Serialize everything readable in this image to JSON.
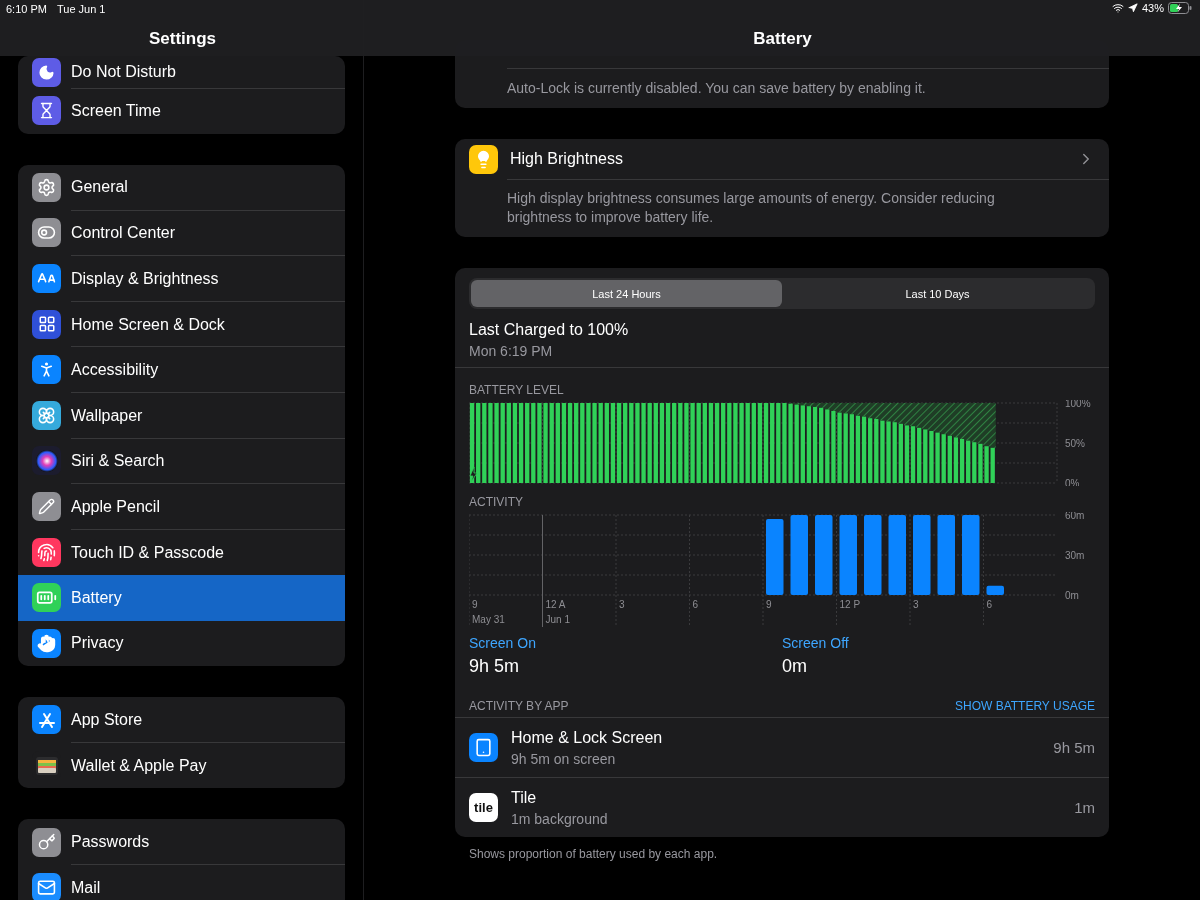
{
  "status_bar": {
    "time": "6:10 PM",
    "date": "Tue Jun 1",
    "battery": "43%"
  },
  "header": {
    "sidebar_title": "Settings",
    "title": "Battery"
  },
  "sidebar": {
    "groups": [
      {
        "items": [
          {
            "label": "Do Not Disturb",
            "kind": "dnd",
            "selected": false
          },
          {
            "label": "Screen Time",
            "kind": "screentime",
            "selected": false
          }
        ]
      },
      {
        "items": [
          {
            "label": "General",
            "kind": "general",
            "selected": false
          },
          {
            "label": "Control Center",
            "kind": "control",
            "selected": false
          },
          {
            "label": "Display & Brightness",
            "kind": "display",
            "selected": false
          },
          {
            "label": "Home Screen & Dock",
            "kind": "home",
            "selected": false
          },
          {
            "label": "Accessibility",
            "kind": "accessibility",
            "selected": false
          },
          {
            "label": "Wallpaper",
            "kind": "wallpaper",
            "selected": false
          },
          {
            "label": "Siri & Search",
            "kind": "siri",
            "selected": false
          },
          {
            "label": "Apple Pencil",
            "kind": "pencil",
            "selected": false
          },
          {
            "label": "Touch ID & Passcode",
            "kind": "touchid",
            "selected": false
          },
          {
            "label": "Battery",
            "kind": "battery",
            "selected": true
          },
          {
            "label": "Privacy",
            "kind": "privacy",
            "selected": false
          }
        ]
      },
      {
        "items": [
          {
            "label": "App Store",
            "kind": "appstore",
            "selected": false
          },
          {
            "label": "Wallet & Apple Pay",
            "kind": "wallet",
            "selected": false
          }
        ]
      },
      {
        "items": [
          {
            "label": "Passwords",
            "kind": "passwords",
            "selected": false
          },
          {
            "label": "Mail",
            "kind": "mail",
            "selected": false
          }
        ]
      }
    ]
  },
  "insights": [
    {
      "description": "Auto-Lock is currently disabled. You can save battery by enabling it."
    },
    {
      "title": "High Brightness",
      "kind": "brightness",
      "description": "High display brightness consumes large amounts of energy. Consider reducing brightness to improve battery life."
    }
  ],
  "usage": {
    "tabs": [
      {
        "label": "Last 24 Hours",
        "selected": true
      },
      {
        "label": "Last 10 Days",
        "selected": false
      }
    ],
    "last_charged": {
      "title": "Last Charged to 100%",
      "time": "Mon 6:19 PM"
    },
    "battery_level": {
      "charging": true,
      "chart_data": {
        "type": "bar",
        "title": "BATTERY LEVEL",
        "ylim": [
          0,
          100
        ],
        "yticks": [
          {
            "value": 0,
            "label": "0%"
          },
          {
            "value": 50,
            "label": "50%"
          },
          {
            "value": 100,
            "label": "100%"
          }
        ],
        "values": [
          100,
          100,
          100,
          100,
          100,
          100,
          100,
          100,
          100,
          100,
          100,
          100,
          100,
          100,
          100,
          100,
          100,
          100,
          100,
          100,
          100,
          100,
          100,
          100,
          100,
          100,
          100,
          100,
          100,
          100,
          100,
          100,
          100,
          100,
          100,
          100,
          100,
          100,
          100,
          100,
          100,
          100,
          100,
          100,
          100,
          100,
          100,
          100,
          100,
          100,
          100,
          100,
          99,
          98,
          97,
          96,
          95,
          94,
          92,
          90,
          88,
          87,
          86,
          84,
          83,
          81,
          80,
          78,
          77,
          76,
          74,
          72,
          71,
          69,
          67,
          65,
          63,
          61,
          59,
          57,
          55,
          53,
          51,
          49,
          46,
          44,
          null,
          null,
          null,
          null,
          null,
          null,
          null,
          null,
          null,
          null
        ]
      }
    },
    "activity": {
      "chart_data": {
        "type": "bar",
        "title": "ACTIVITY",
        "ylim": [
          0,
          60
        ],
        "yticks": [
          {
            "value": 0,
            "label": "0m"
          },
          {
            "value": 30,
            "label": "30m"
          },
          {
            "value": 60,
            "label": "60m"
          }
        ],
        "categories": [
          "9",
          null,
          null,
          "12 A",
          null,
          null,
          "3",
          null,
          null,
          "6",
          null,
          null,
          "9",
          null,
          null,
          "12 P",
          null,
          null,
          "3",
          null,
          null,
          "6",
          null,
          null
        ],
        "annotations": [
          "May 31",
          "Jun 1"
        ],
        "values": [
          0,
          0,
          0,
          0,
          0,
          0,
          0,
          0,
          0,
          0,
          0,
          0,
          57,
          60,
          60,
          60,
          60,
          60,
          60,
          60,
          60,
          7,
          0,
          0
        ]
      }
    },
    "totals": [
      {
        "label": "Screen On",
        "value": "9h 5m"
      },
      {
        "label": "Screen Off",
        "value": "0m"
      }
    ],
    "apps_heading": "ACTIVITY BY APP",
    "apps_link": "SHOW BATTERY USAGE",
    "apps": [
      {
        "kind": "home",
        "name": "Home & Lock Screen",
        "detail": "9h 5m on screen",
        "usage": "9h 5m"
      },
      {
        "kind": "tile",
        "icon_text": "tile",
        "name": "Tile",
        "detail": "1m background",
        "usage": "1m"
      }
    ]
  },
  "footer": "Shows proportion of battery used by each app."
}
